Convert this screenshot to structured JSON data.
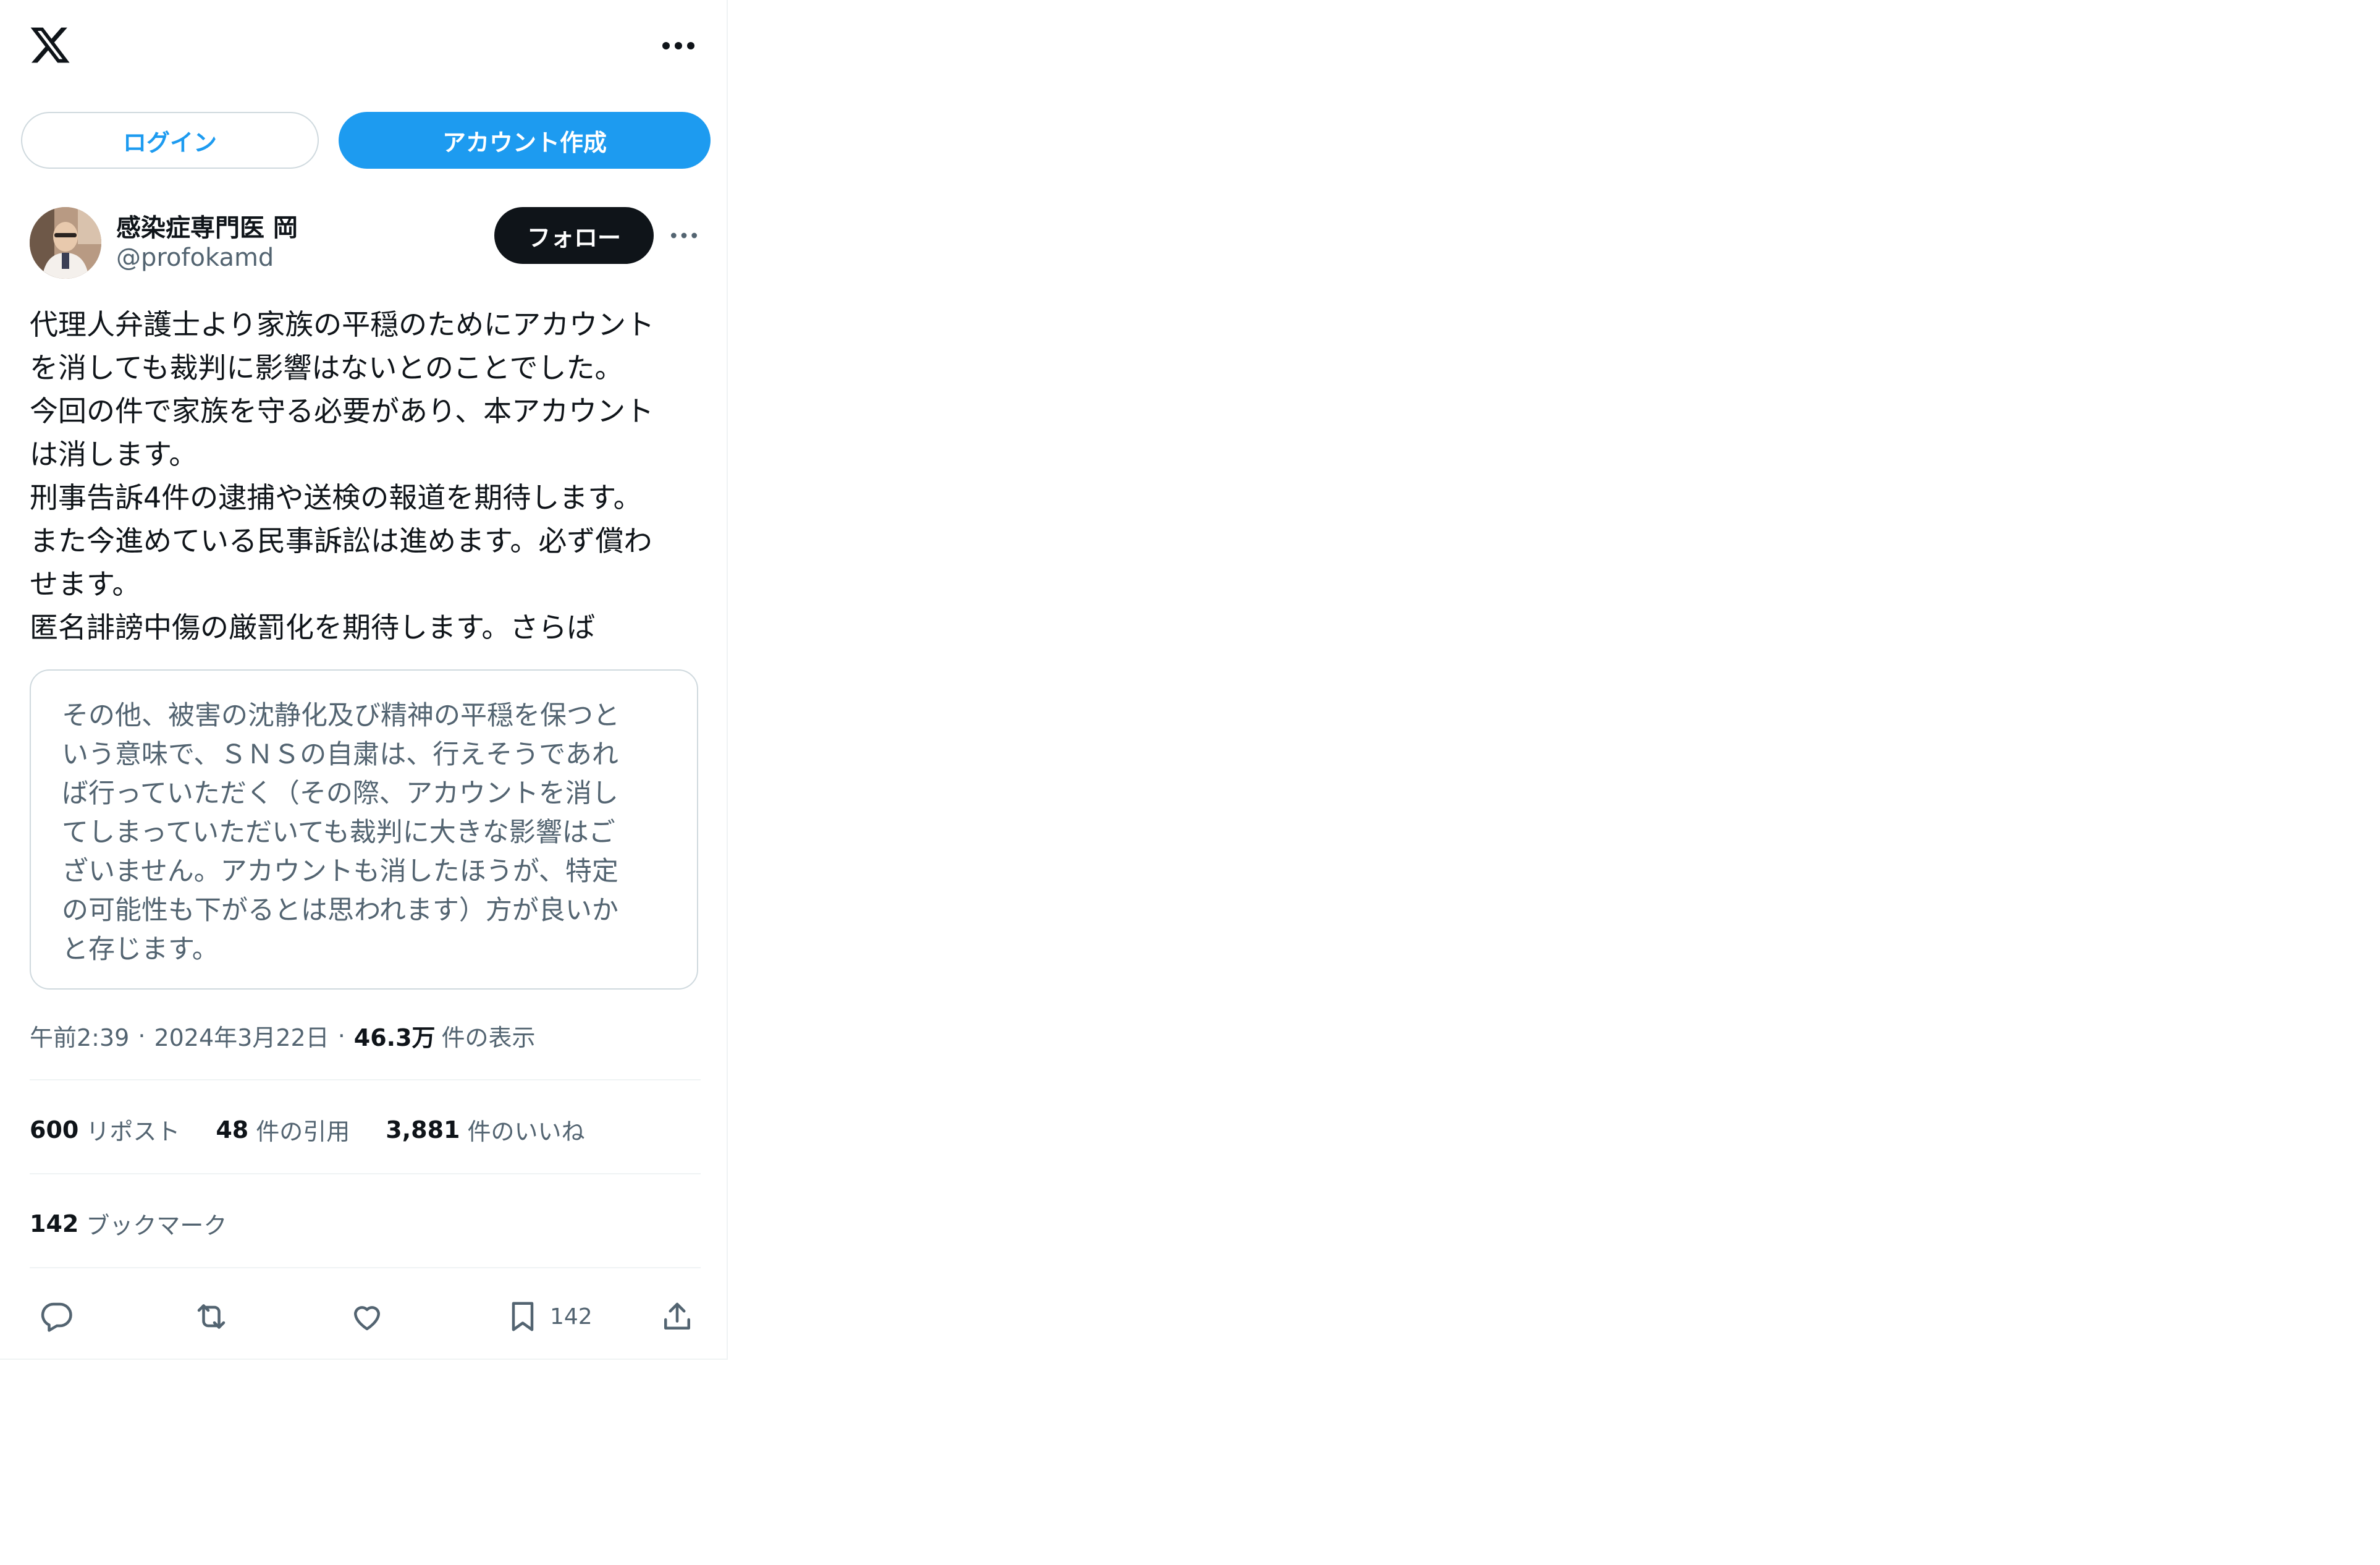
{
  "header": {
    "logo_icon": "x-logo-icon",
    "more_icon": "more-horizontal-icon"
  },
  "auth": {
    "login_label": "ログイン",
    "signup_label": "アカウント作成",
    "accent_color": "#1d9bf0"
  },
  "tweet": {
    "author": {
      "display_name": "感染症専門医 岡",
      "handle": "@profokamd"
    },
    "follow_label": "フォロー",
    "text": "代理人弁護士より家族の平穏のためにアカウント\nを消しても裁判に影響はないとのことでした。\n今回の件で家族を守る必要があり、本アカウント\nは消します。\n刑事告訴4件の逮捕や送検の報道を期待します。\nまた今進めている民事訴訟は進めます。必ず償わ\nせます。\n匿名誹謗中傷の厳罰化を期待します。さらば",
    "quote": "その他、被害の沈静化及び精神の平穏を保つと\nいう意味で、ＳＮＳの自粛は、行えそうであれ\nば行っていただく（その際、アカウントを消し\nてしまっていただいても裁判に大きな影響はご\nざいません。アカウントも消したほうが、特定\nの可能性も下がるとは思われます）方が良いか\nと存じます。",
    "time": "午前2:39",
    "date": "2024年3月22日",
    "views": "46.3万",
    "views_label": "件の表示",
    "separator": "·",
    "stats": {
      "reposts": "600",
      "reposts_label": "リポスト",
      "quotes": "48",
      "quotes_label": "件の引用",
      "likes": "3,881",
      "likes_label": "件のいいね",
      "bookmarks": "142",
      "bookmarks_label": "ブックマーク"
    },
    "actions": {
      "reply_icon": "reply-icon",
      "repost_icon": "repost-icon",
      "like_icon": "heart-icon",
      "bookmark_icon": "bookmark-icon",
      "bookmark_count": "142",
      "share_icon": "share-icon"
    }
  }
}
